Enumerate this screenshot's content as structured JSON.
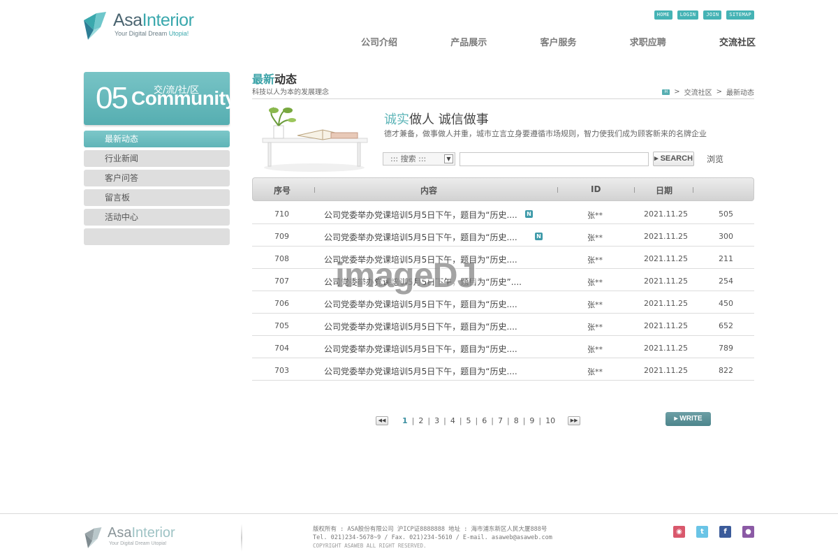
{
  "logo": {
    "brand_a": "Asa",
    "brand_b": "Interior",
    "tagline_a": "Your Digital Dream ",
    "tagline_b": "Utopia!"
  },
  "top_links": [
    "HOME",
    "LOGIN",
    "JOIN",
    "SITEMAP"
  ],
  "nav": [
    "公司介绍",
    "产品展示",
    "客户服务",
    "求职应聘",
    "交流社区"
  ],
  "sidebar": {
    "banner": {
      "number": "05",
      "cn": "交/流/社/区",
      "en": "Community"
    },
    "items": [
      "最新动态",
      "行业新闻",
      "客户问答",
      "留言板",
      "活动中心",
      ""
    ]
  },
  "content": {
    "title_hl": "最新",
    "title_rest": "动态",
    "subtitle": "科技以人为本的发展理念",
    "breadcrumb": [
      "交流社区",
      "最新动态"
    ]
  },
  "promo": {
    "head_hl": "诚实",
    "head_rest": "做人  诚信做事",
    "body": "德才兼备，做事做人并重，城市立言立身要遵循市场规则，智力使我们成为顾客新来的名牌企业"
  },
  "search": {
    "select": "::: 搜索 :::",
    "button": "SEARCH",
    "browse": "浏览"
  },
  "table": {
    "headers": [
      "序号",
      "内容",
      "ID",
      "日期"
    ],
    "rows": [
      {
        "no": "710",
        "title": "公司党委举办党课培训5月5日下午，题目为“历史....",
        "new": "N",
        "id": "张**",
        "date": "2021.11.25",
        "views": "505"
      },
      {
        "no": "709",
        "title": "公司党委举办党课培训5月5日下午，题目为“历史....",
        "new": "N",
        "id": "张**",
        "date": "2021.11.25",
        "views": "300"
      },
      {
        "no": "708",
        "title": "公司党委举办党课培训5月5日下午，题目为“历史....",
        "new": "",
        "id": "张**",
        "date": "2021.11.25",
        "views": "211"
      },
      {
        "no": "707",
        "title": "公司党委举办党课培训5月5日下午，题目为“历史”....",
        "new": "",
        "id": "张**",
        "date": "2021.11.25",
        "views": "254"
      },
      {
        "no": "706",
        "title": "公司党委举办党课培训5月5日下午，题目为“历史....",
        "new": "",
        "id": "张**",
        "date": "2021.11.25",
        "views": "450"
      },
      {
        "no": "705",
        "title": "公司党委举办党课培训5月5日下午，题目为“历史....",
        "new": "",
        "id": "张**",
        "date": "2021.11.25",
        "views": "652"
      },
      {
        "no": "704",
        "title": "公司党委举办党课培训5月5日下午，题目为“历史....",
        "new": "",
        "id": "张**",
        "date": "2021.11.25",
        "views": "789"
      },
      {
        "no": "703",
        "title": "公司党委举办党课培训5月5日下午，题目为“历史....",
        "new": "",
        "id": "张**",
        "date": "2021.11.25",
        "views": "822"
      }
    ]
  },
  "watermark": "imageDJ",
  "pagination": {
    "pages": [
      "1",
      "2",
      "3",
      "4",
      "5",
      "6",
      "7",
      "8",
      "9",
      "10"
    ],
    "current": "1",
    "write": "WRITE"
  },
  "footer": {
    "line1": "版权所有 : ASA股份有限公司 沪ICP证8888888   地址 : 海市浦东新区人民大厦888号",
    "line2": "Tel. 021)234-5678~9  / Fax. 021)234-5610  / E-mail. asaweb@asaweb.com",
    "line3": "COPYRIGHT ASAWEB ALL RIGHT RESERVED."
  },
  "colors": {
    "accent": "#56aeb1",
    "new_badge": "#3e9aa9",
    "write_button": "#5a9097"
  }
}
